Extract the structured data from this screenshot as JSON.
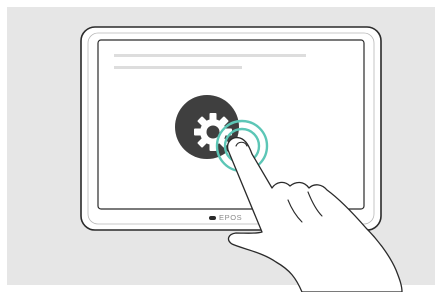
{
  "device": {
    "brand_label": "EPOS"
  },
  "colors": {
    "background": "#e6e6e6",
    "device_frame": "#ffffff",
    "outline": "#2a2a2a",
    "screen": "#ffffff",
    "placeholder_line": "#dddddd",
    "gear_button": "#3f3f3f",
    "touch_ripple": "#5cc6b6"
  },
  "icons": {
    "settings": "gear-icon",
    "touch_feedback": "tap-ripple-icon",
    "hand": "pointing-hand-icon"
  }
}
